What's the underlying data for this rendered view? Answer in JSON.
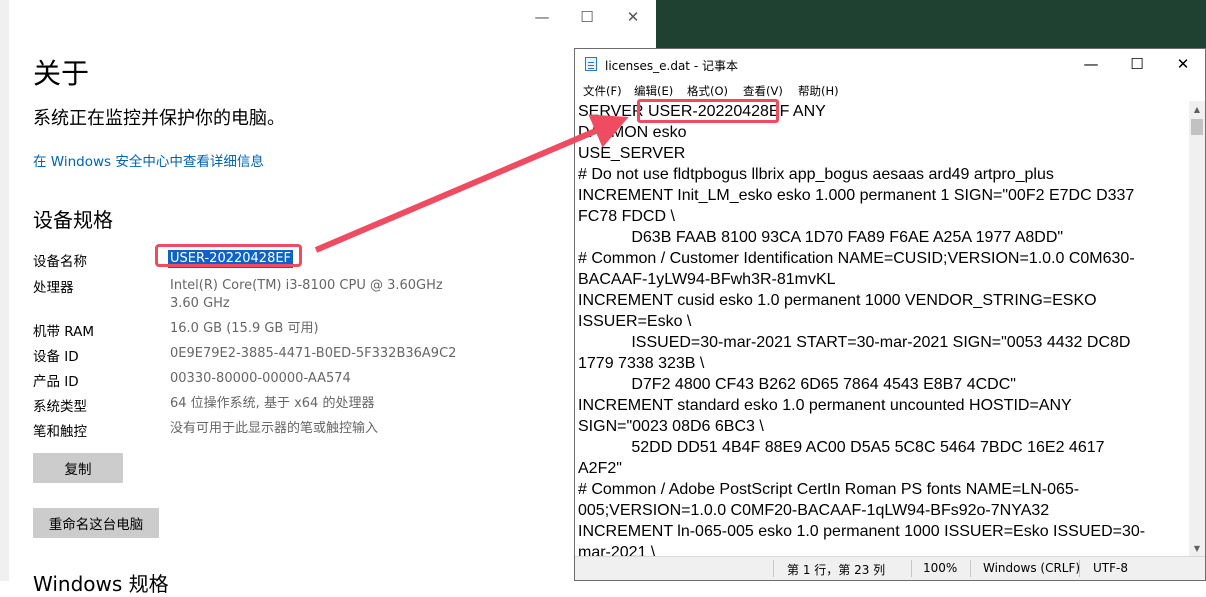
{
  "settings": {
    "title": "关于",
    "subtitle": "系统正在监控并保护你的电脑。",
    "security_link": "在 Windows 安全中心中查看详细信息",
    "spec_heading": "设备规格",
    "specs": [
      {
        "label": "设备名称",
        "value": "USER-20220428EF"
      },
      {
        "label": "处理器",
        "value": "Intel(R) Core(TM) i3-8100 CPU @ 3.60GHz   3.60 GHz"
      },
      {
        "label": "机带 RAM",
        "value": "16.0 GB (15.9 GB 可用)"
      },
      {
        "label": "设备 ID",
        "value": "0E9E79E2-3885-4471-B0ED-5F332B36A9C2"
      },
      {
        "label": "产品 ID",
        "value": "00330-80000-00000-AA574"
      },
      {
        "label": "系统类型",
        "value": "64 位操作系统, 基于 x64 的处理器"
      },
      {
        "label": "笔和触控",
        "value": "没有可用于此显示器的笔或触控输入"
      }
    ],
    "copy_button": "复制",
    "rename_button": "重命名这台电脑",
    "windows_spec_heading": "Windows 规格",
    "controls": {
      "minimize": "—",
      "maximize": "☐",
      "close": "✕"
    }
  },
  "notepad": {
    "title": "licenses_e.dat - 记事本",
    "controls": {
      "minimize": "—",
      "maximize": "☐",
      "close": "✕"
    },
    "menus": [
      "文件(F)",
      "编辑(E)",
      "格式(O)",
      "查看(V)",
      "帮助(H)"
    ],
    "lines": [
      "SERVER USER-20220428EF ANY",
      "DAEMON esko",
      "USE_SERVER",
      "# Do not use fldtpbogus llbrix app_bogus aesaas ard49 artpro_plus",
      "INCREMENT Init_LM_esko esko 1.000 permanent 1 SIGN=\"00F2 E7DC D337",
      "FC78 FDCD \\",
      "            D63B FAAB 8100 93CA 1D70 FA89 F6AE A25A 1977 A8DD\"",
      "# Common / Customer Identification NAME=CUSID;VERSION=1.0.0 C0M630-",
      "BACAAF-1yLW94-BFwh3R-81mvKL",
      "INCREMENT cusid esko 1.0 permanent 1000 VENDOR_STRING=ESKO",
      "ISSUER=Esko \\",
      "            ISSUED=30-mar-2021 START=30-mar-2021 SIGN=\"0053 4432 DC8D",
      "1779 7338 323B \\",
      "            D7F2 4800 CF43 B262 6D65 7864 4543 E8B7 4CDC\"",
      "INCREMENT standard esko 1.0 permanent uncounted HOSTID=ANY",
      "SIGN=\"0023 08D6 6BC3 \\",
      "            52DD DD51 4B4F 88E9 AC00 D5A5 5C8C 5464 7BDC 16E2 4617",
      "A2F2\"",
      "# Common / Adobe PostScript CertIn Roman PS fonts NAME=LN-065-",
      "005;VERSION=1.0.0 C0MF20-BACAAF-1qLW94-BFs92o-7NYA32",
      "INCREMENT ln-065-005 esko 1.0 permanent 1000 ISSUER=Esko ISSUED=30-",
      "mar-2021 \\"
    ],
    "status": {
      "position": "第 1 行，第 23 列",
      "zoom": "100%",
      "line_ending": "Windows (CRLF)",
      "encoding": "UTF-8"
    }
  },
  "annotation": {
    "highlight_color": "#ef4b61"
  }
}
